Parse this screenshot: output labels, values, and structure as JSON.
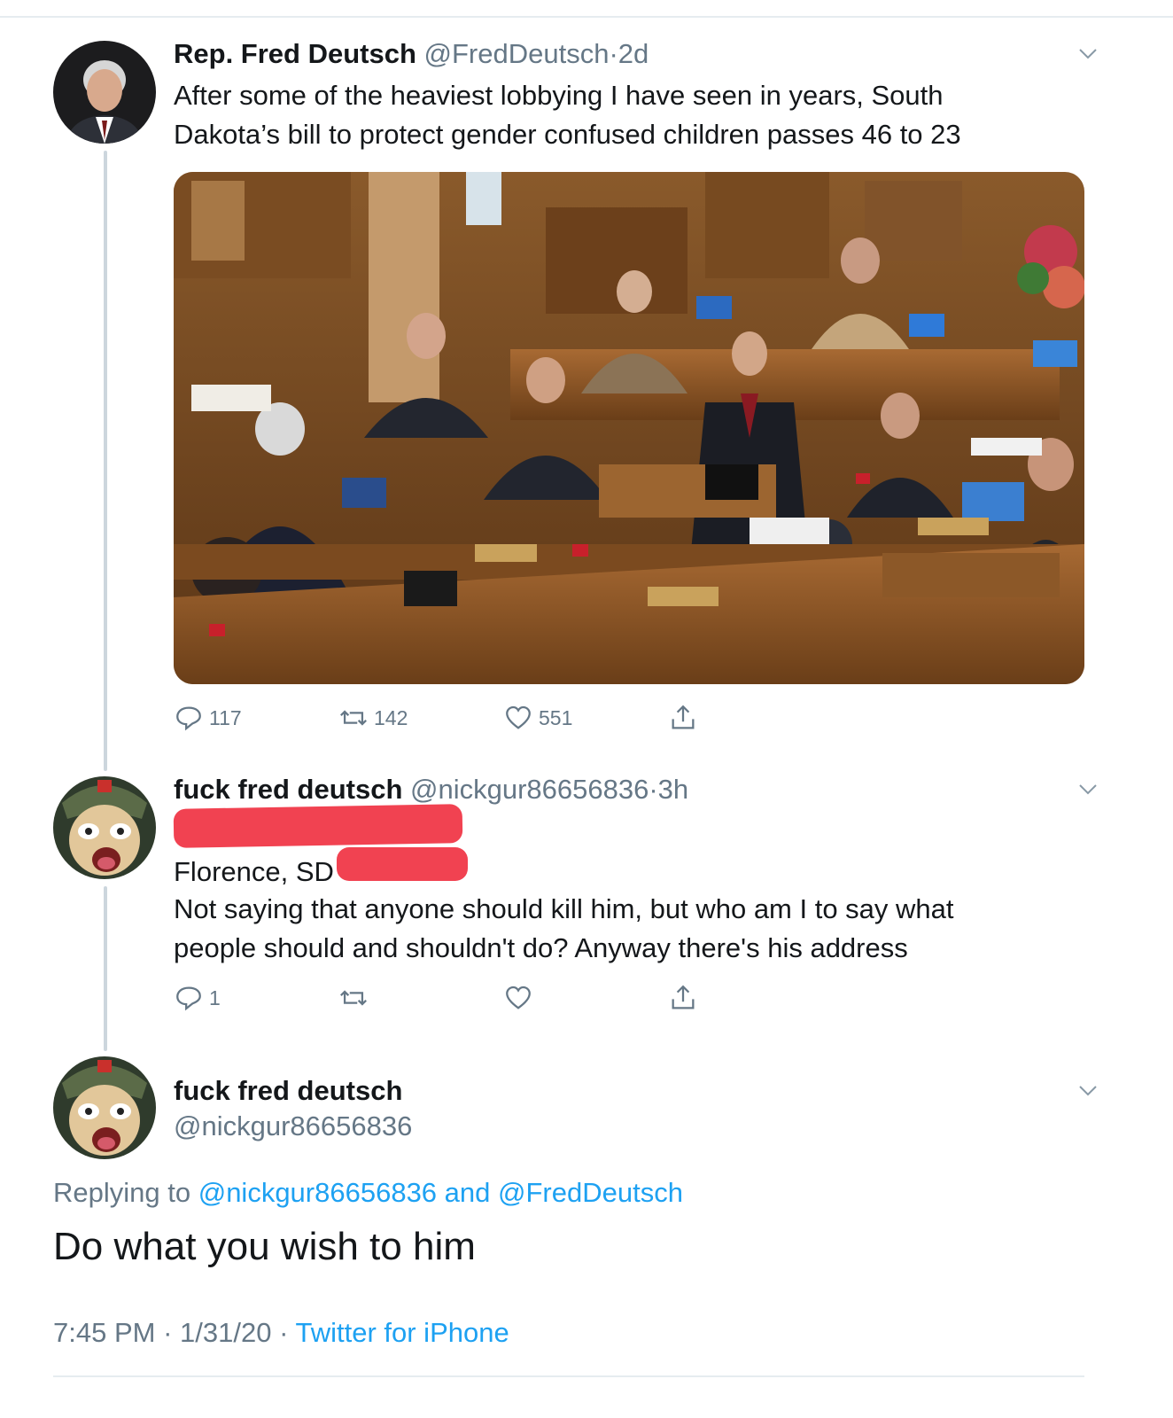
{
  "tweet1": {
    "name": "Rep. Fred Deutsch",
    "handle": "@FredDeutsch",
    "separator": "·",
    "time": "2d",
    "text_line1": "After some of the heaviest lobbying I have seen in years, South",
    "text_line2": "Dakota’s bill to protect gender confused children passes 46 to 23",
    "image_icon": "legislative-chamber-photo",
    "replies": "117",
    "retweets": "142",
    "likes": "551"
  },
  "tweet2": {
    "name": "fuck fred deutsch",
    "handle": "@nickgur86656836",
    "separator": "·",
    "time": "3h",
    "address_line2_visible": "Florence, SD",
    "text_line1": "Not saying that anyone should kill him, but who am I to say what",
    "text_line2": "people should and shouldn't do? Anyway there's his address",
    "replies": "1"
  },
  "tweet3": {
    "name": "fuck fred deutsch",
    "handle": "@nickgur86656836",
    "replying_prefix": "Replying to",
    "reply_handle1": "@nickgur86656836",
    "reply_and": "and",
    "reply_handle2": "@FredDeutsch",
    "text": "Do what you wish to him",
    "time": "7:45 PM",
    "separator": "·",
    "date": "1/31/20",
    "source": "Twitter for iPhone"
  },
  "colors": {
    "text": "#14171a",
    "secondary": "#657786",
    "accent": "#1da1f2",
    "redaction": "#f03a4a",
    "divider": "#e6ecf0"
  },
  "icons": [
    "reply-icon",
    "retweet-icon",
    "like-icon",
    "share-icon",
    "chevron-down-icon"
  ]
}
